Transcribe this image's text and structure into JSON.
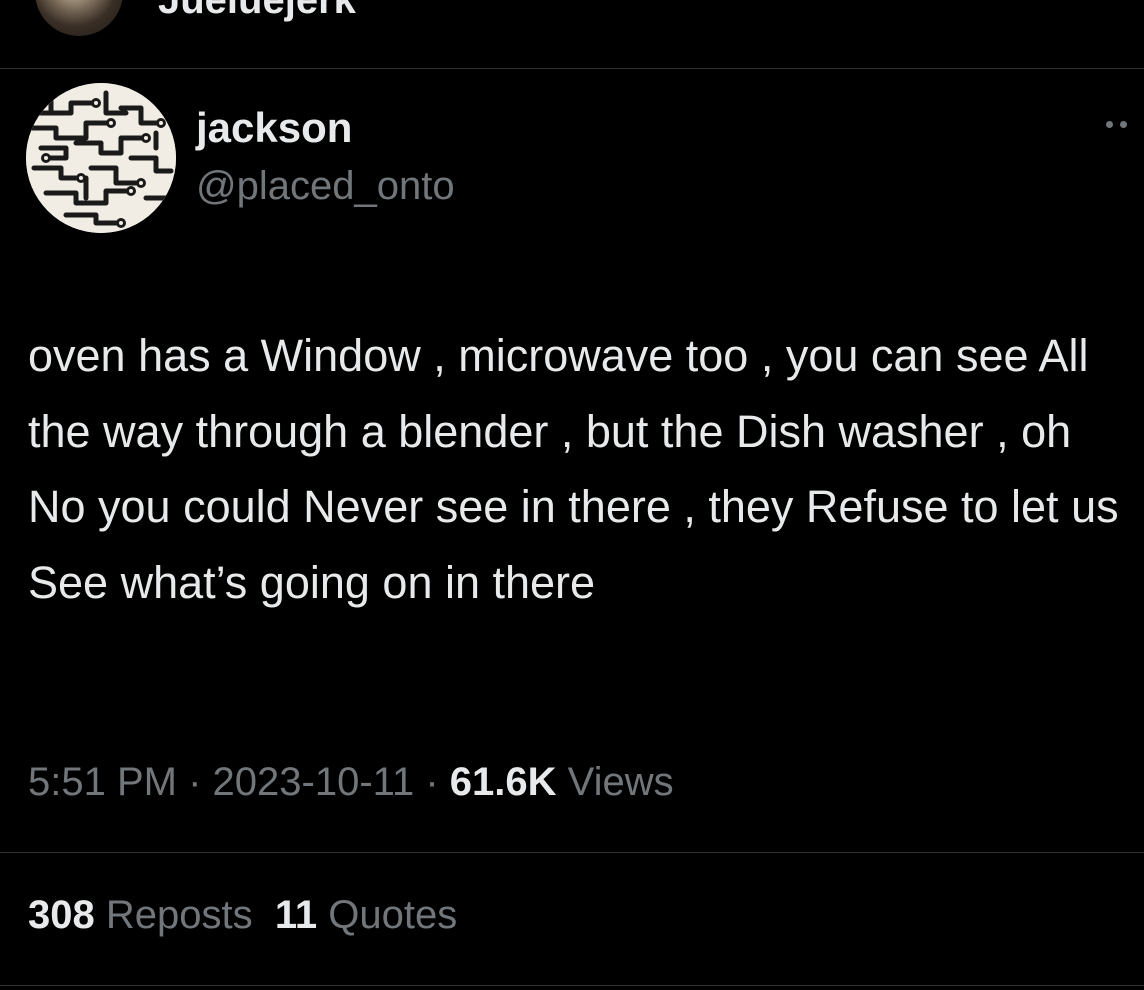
{
  "previous_tweet": {
    "author_name": "Jueluejerk"
  },
  "tweet": {
    "author": {
      "display_name": "jackson",
      "handle": "@placed_onto"
    },
    "more_icon": "ellipsis-icon",
    "text": "oven has a Window , microwave too , you can see All the way through a blender , but the Dish washer , oh No you could Never see in there , they Refuse to let us See what’s going on in there",
    "meta": {
      "time": "5:51 PM",
      "separator": "·",
      "date": "2023-10-11",
      "views_count": "61.6K",
      "views_label": "Views"
    },
    "stats": {
      "reposts_count": "308",
      "reposts_label": "Reposts",
      "quotes_count": "11",
      "quotes_label": "Quotes"
    }
  },
  "colors": {
    "background": "#000000",
    "primary_text": "#e7e9ea",
    "secondary_text": "#71767b",
    "divider": "#2f3336"
  }
}
